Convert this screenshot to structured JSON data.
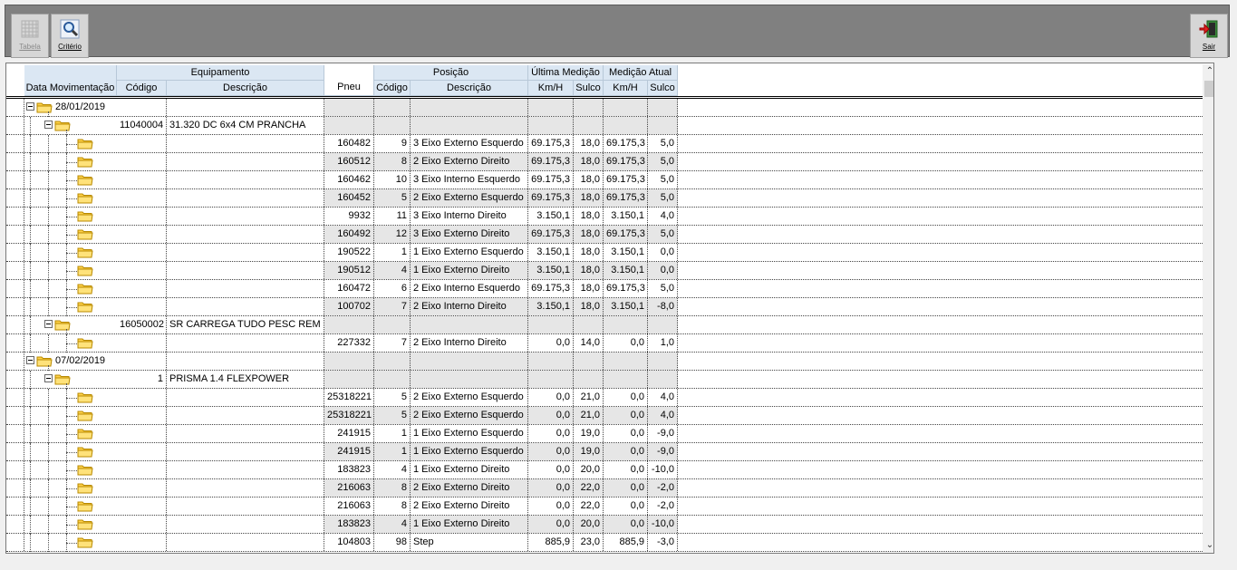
{
  "toolbar": {
    "tabela_label": "Tabela",
    "criterio_label": "Critério",
    "sair_label": "Sair"
  },
  "columns": {
    "data_mov": "Data Movimentação",
    "equipamento": "Equipamento",
    "equip_codigo": "Código",
    "equip_descricao": "Descrição",
    "pneu": "Pneu",
    "posicao": "Posição",
    "pos_codigo": "Código",
    "pos_descricao": "Descrição",
    "ultima_medicao": "Última Medição",
    "ultima_km": "Km/H",
    "ultima_sulco": "Sulco",
    "medicao_atual": "Medição Atual",
    "atual_km": "Km/H",
    "atual_sulco": "Sulco"
  },
  "rows": [
    {
      "level": 0,
      "label": "28/01/2019"
    },
    {
      "level": 1,
      "ecod": "11040004",
      "edesc": "31.320 DC 6x4 CM PRANCHA"
    },
    {
      "level": 2,
      "pneu": "160482",
      "pcod": "9",
      "pdesc": "3 Eixo Externo Esquerdo",
      "km1": "69.175,3",
      "s1": "18,0",
      "km2": "69.175,3",
      "s2": "5,0"
    },
    {
      "level": 2,
      "pneu": "160512",
      "pcod": "8",
      "pdesc": "2 Eixo Externo Direito",
      "km1": "69.175,3",
      "s1": "18,0",
      "km2": "69.175,3",
      "s2": "5,0"
    },
    {
      "level": 2,
      "pneu": "160462",
      "pcod": "10",
      "pdesc": "3 Eixo Interno Esquerdo",
      "km1": "69.175,3",
      "s1": "18,0",
      "km2": "69.175,3",
      "s2": "5,0"
    },
    {
      "level": 2,
      "pneu": "160452",
      "pcod": "5",
      "pdesc": "2 Eixo Externo Esquerdo",
      "km1": "69.175,3",
      "s1": "18,0",
      "km2": "69.175,3",
      "s2": "5,0"
    },
    {
      "level": 2,
      "pneu": "9932",
      "pcod": "11",
      "pdesc": "3 Eixo Interno Direito",
      "km1": "3.150,1",
      "s1": "18,0",
      "km2": "3.150,1",
      "s2": "4,0"
    },
    {
      "level": 2,
      "pneu": "160492",
      "pcod": "12",
      "pdesc": "3 Eixo Externo Direito",
      "km1": "69.175,3",
      "s1": "18,0",
      "km2": "69.175,3",
      "s2": "5,0"
    },
    {
      "level": 2,
      "pneu": "190522",
      "pcod": "1",
      "pdesc": "1 Eixo Externo Esquerdo",
      "km1": "3.150,1",
      "s1": "18,0",
      "km2": "3.150,1",
      "s2": "0,0"
    },
    {
      "level": 2,
      "pneu": "190512",
      "pcod": "4",
      "pdesc": "1 Eixo Externo Direito",
      "km1": "3.150,1",
      "s1": "18,0",
      "km2": "3.150,1",
      "s2": "0,0"
    },
    {
      "level": 2,
      "pneu": "160472",
      "pcod": "6",
      "pdesc": "2 Eixo Interno Esquerdo",
      "km1": "69.175,3",
      "s1": "18,0",
      "km2": "69.175,3",
      "s2": "5,0"
    },
    {
      "level": 2,
      "pneu": "100702",
      "pcod": "7",
      "pdesc": "2 Eixo Interno Direito",
      "km1": "3.150,1",
      "s1": "18,0",
      "km2": "3.150,1",
      "s2": "-8,0"
    },
    {
      "level": 1,
      "ecod": "16050002",
      "edesc": "SR CARREGA TUDO PESC REM"
    },
    {
      "level": 2,
      "pneu": "227332",
      "pcod": "7",
      "pdesc": "2 Eixo Interno Direito",
      "km1": "0,0",
      "s1": "14,0",
      "km2": "0,0",
      "s2": "1,0"
    },
    {
      "level": 0,
      "label": "07/02/2019"
    },
    {
      "level": 1,
      "ecod": "1",
      "edesc": "PRISMA 1.4 FLEXPOWER"
    },
    {
      "level": 2,
      "pneu": "25318221",
      "pcod": "5",
      "pdesc": "2 Eixo Externo Esquerdo",
      "km1": "0,0",
      "s1": "21,0",
      "km2": "0,0",
      "s2": "4,0"
    },
    {
      "level": 2,
      "pneu": "25318221",
      "pcod": "5",
      "pdesc": "2 Eixo Externo Esquerdo",
      "km1": "0,0",
      "s1": "21,0",
      "km2": "0,0",
      "s2": "4,0"
    },
    {
      "level": 2,
      "pneu": "241915",
      "pcod": "1",
      "pdesc": "1 Eixo Externo Esquerdo",
      "km1": "0,0",
      "s1": "19,0",
      "km2": "0,0",
      "s2": "-9,0"
    },
    {
      "level": 2,
      "pneu": "241915",
      "pcod": "1",
      "pdesc": "1 Eixo Externo Esquerdo",
      "km1": "0,0",
      "s1": "19,0",
      "km2": "0,0",
      "s2": "-9,0"
    },
    {
      "level": 2,
      "pneu": "183823",
      "pcod": "4",
      "pdesc": "1 Eixo Externo Direito",
      "km1": "0,0",
      "s1": "20,0",
      "km2": "0,0",
      "s2": "-10,0"
    },
    {
      "level": 2,
      "pneu": "216063",
      "pcod": "8",
      "pdesc": "2 Eixo Externo Direito",
      "km1": "0,0",
      "s1": "22,0",
      "km2": "0,0",
      "s2": "-2,0"
    },
    {
      "level": 2,
      "pneu": "216063",
      "pcod": "8",
      "pdesc": "2 Eixo Externo Direito",
      "km1": "0,0",
      "s1": "22,0",
      "km2": "0,0",
      "s2": "-2,0"
    },
    {
      "level": 2,
      "pneu": "183823",
      "pcod": "4",
      "pdesc": "1 Eixo Externo Direito",
      "km1": "0,0",
      "s1": "20,0",
      "km2": "0,0",
      "s2": "-10,0"
    },
    {
      "level": 2,
      "pneu": "104803",
      "pcod": "98",
      "pdesc": "Step",
      "km1": "885,9",
      "s1": "23,0",
      "km2": "885,9",
      "s2": "-3,0"
    }
  ]
}
